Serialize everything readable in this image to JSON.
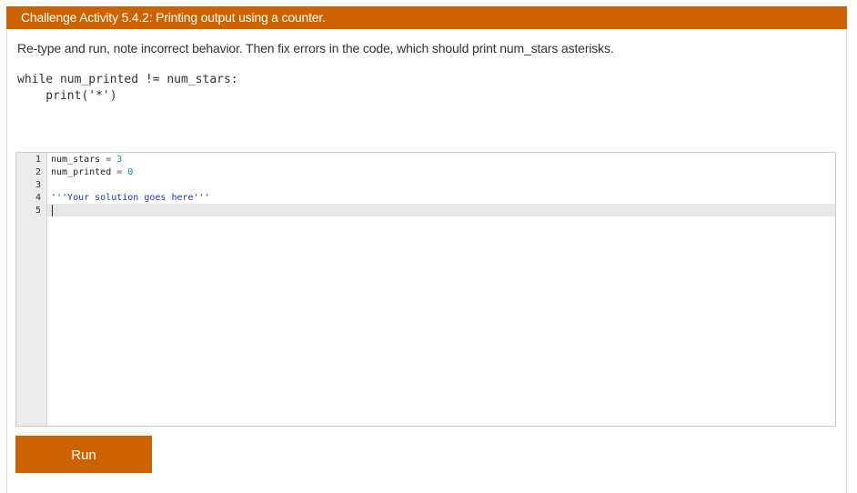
{
  "header": {
    "title": "Challenge Activity 5.4.2: Printing output using a counter."
  },
  "instructions": "Re-type and run, note incorrect behavior. Then fix errors in the code, which should print num_stars asterisks.",
  "code_sample": {
    "line1": "while num_printed != num_stars:",
    "line2": "    print('*')"
  },
  "editor": {
    "lines": [
      {
        "num": "1",
        "parts": {
          "name": "num_stars",
          "op": " = ",
          "val": "3"
        }
      },
      {
        "num": "2",
        "parts": {
          "name": "num_printed",
          "op": " = ",
          "val": "0"
        }
      },
      {
        "num": "3",
        "text": ""
      },
      {
        "num": "4",
        "text": "'''Your solution goes here'''"
      },
      {
        "num": "5",
        "text": ""
      }
    ],
    "active_line": 5
  },
  "run_button": {
    "label": "Run"
  },
  "colors": {
    "accent": "#cc6300",
    "string": "#2233aa",
    "number": "#009999"
  }
}
